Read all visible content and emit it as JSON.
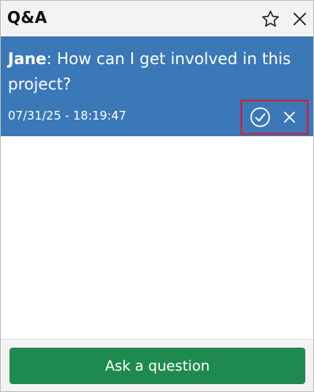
{
  "header": {
    "title": "Q&A",
    "star_icon": "star-outline-icon",
    "close_icon": "close-icon"
  },
  "question": {
    "author": "Jane",
    "separator": ": ",
    "text": "How can I get involved in this project?",
    "timestamp": "07/31/25 - 18:19:47",
    "approve_icon": "check-circle-icon",
    "dismiss_icon": "close-icon",
    "highlight_color": "#e0182d",
    "background_color": "#3a78b8"
  },
  "footer": {
    "ask_label": "Ask a question",
    "button_color": "#1f8a4f"
  }
}
